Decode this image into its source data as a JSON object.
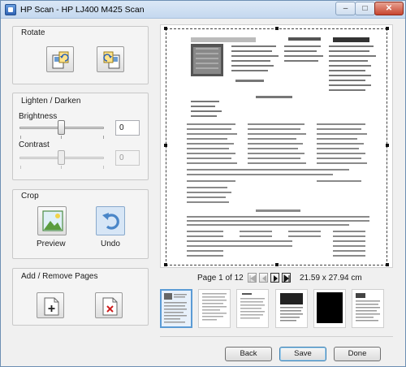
{
  "window": {
    "title": "HP Scan - HP LJ400 M425 Scan",
    "controls": {
      "minimize": "–",
      "maximize": "□",
      "close": "✕"
    }
  },
  "rotate": {
    "label": "Rotate",
    "left_icon": "rotate-left-icon",
    "right_icon": "rotate-right-icon"
  },
  "lighten": {
    "label": "Lighten / Darken",
    "brightness": {
      "label": "Brightness",
      "value": "0",
      "level": 0.5
    },
    "contrast": {
      "label": "Contrast",
      "value": "0",
      "level": 0.5,
      "disabled": true
    }
  },
  "crop": {
    "label": "Crop",
    "preview_label": "Preview",
    "undo_label": "Undo",
    "icons": {
      "preview": "image-preview-icon",
      "undo": "undo-arrow-icon"
    }
  },
  "pages": {
    "label": "Add / Remove Pages",
    "add_icon": "add-page-icon",
    "remove_icon": "remove-page-icon"
  },
  "pager": {
    "text": "Page 1 of 12",
    "size": "21.59 x 27.94 cm"
  },
  "footer": {
    "back": "Back",
    "save": "Save",
    "done": "Done"
  },
  "colors": {
    "accent": "#5b9bd5",
    "close_button": "#c7452f",
    "undo_blue": "#4a86c8"
  }
}
